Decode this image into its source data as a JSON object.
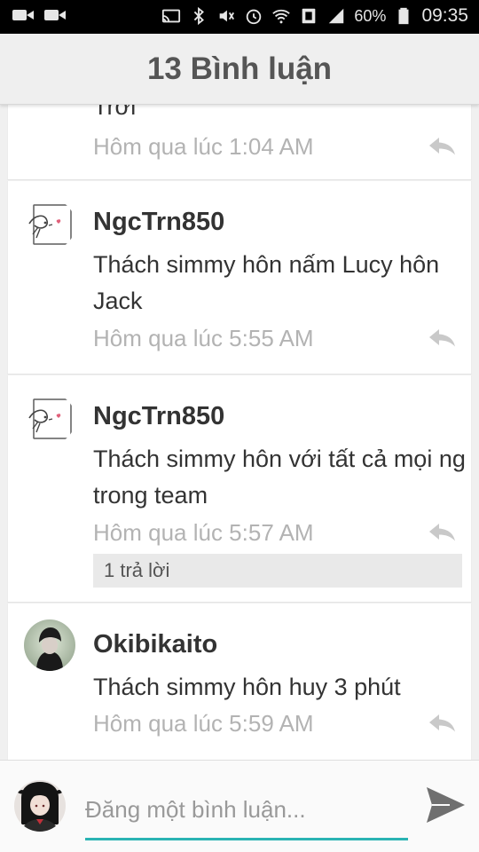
{
  "status_bar": {
    "battery_percent": "60%",
    "time": "09:35",
    "icons": [
      "video-icon",
      "video-icon",
      "cast-icon",
      "bluetooth-icon",
      "mute-icon",
      "alarm-icon",
      "wifi-icon",
      "nfc-icon",
      "signal-icon",
      "battery-icon"
    ]
  },
  "header": {
    "title": "13 Bình luận"
  },
  "comments": [
    {
      "text": "Trời",
      "time": "Hôm qua lúc 1:04 AM"
    },
    {
      "username": "NgcTrn850",
      "text": "Thách simmy hôn nấm Lucy hôn Jack",
      "time": "Hôm qua lúc 5:55 AM"
    },
    {
      "username": "NgcTrn850",
      "text": "Thách simmy hôn với tất cả mọi ng trong team",
      "time": "Hôm qua lúc 5:57 AM",
      "replies_label": "1 trả lời"
    },
    {
      "username": "Okibikaito",
      "text": "Thách simmy hôn huy 3 phút",
      "time": "Hôm qua lúc 5:59 AM"
    }
  ],
  "composer": {
    "placeholder": "Đăng một bình luận..."
  },
  "colors": {
    "accent": "#2ab3b3",
    "timestamp": "#b3b3b3",
    "header_bg": "#efefef"
  }
}
